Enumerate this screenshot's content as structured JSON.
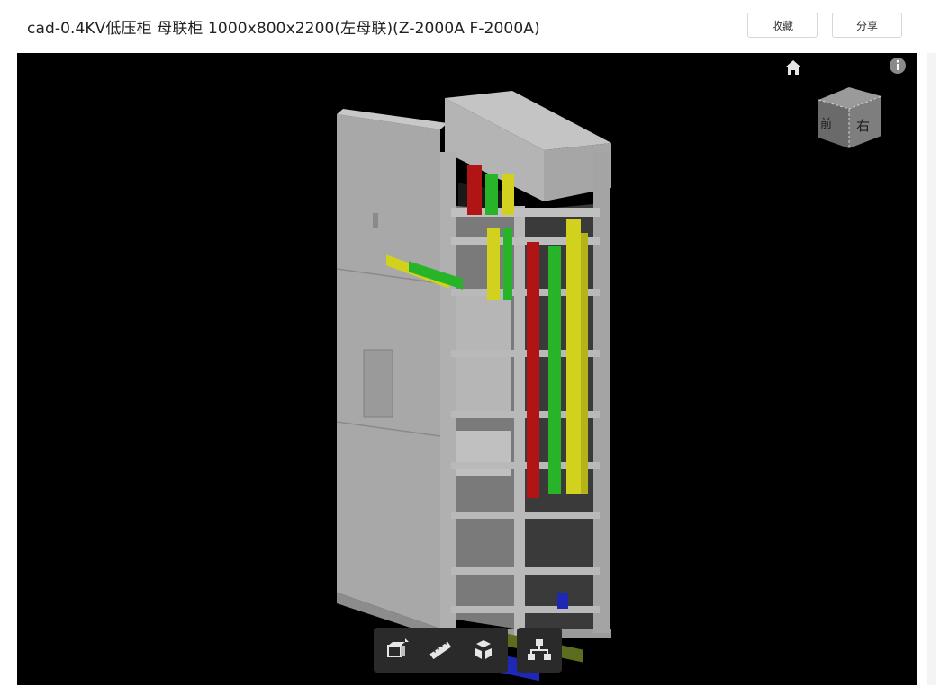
{
  "header": {
    "title": "cad-0.4KV低压柜 母联柜 1000x800x2200(左母联)(Z-2000A F-2000A)",
    "favorite_label": "收藏",
    "share_label": "分享"
  },
  "viewer": {
    "background": "#000000",
    "viewcube": {
      "front_label": "前",
      "right_label": "右"
    },
    "toolbar": {
      "items": [
        {
          "name": "section-tool",
          "icon": "section-box-icon"
        },
        {
          "name": "measure-tool",
          "icon": "ruler-icon"
        },
        {
          "name": "explode-tool",
          "icon": "explode-cubes-icon"
        },
        {
          "name": "model-tree-tool",
          "icon": "hierarchy-icon"
        }
      ]
    },
    "busbar_colors": {
      "red": "#b01414",
      "green": "#28b428",
      "yellow": "#d2d21e",
      "blue": "#1e28b4",
      "olive": "#5a6e1e"
    }
  }
}
